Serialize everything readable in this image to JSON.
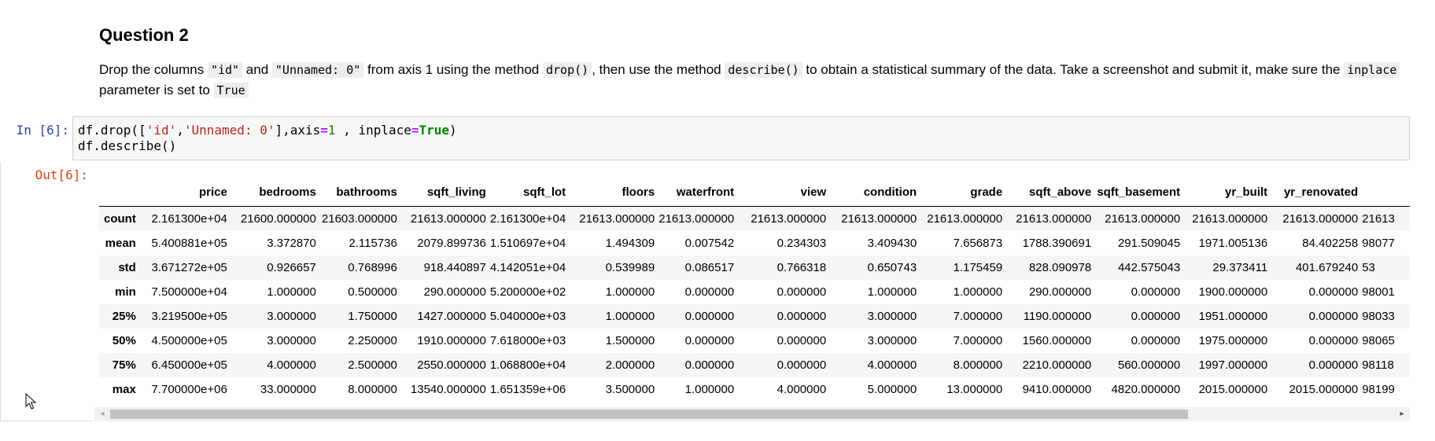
{
  "markdown": {
    "heading": "Question 2",
    "para": {
      "t1": "Drop the columns ",
      "c1": "\"id\"",
      "t2": " and ",
      "c2": "\"Unnamed: 0\"",
      "t3": " from axis 1 using the method ",
      "c3": "drop()",
      "t4": ", then use the method ",
      "c4": "describe()",
      "t5": " to obtain a statistical summary of the data. Take a screenshot and submit it, make sure the ",
      "c5": "inplace",
      "t6": " parameter is set to ",
      "c6": "True"
    }
  },
  "cell": {
    "in_prompt": "In [6]:",
    "out_prompt": "Out[6]:",
    "code": {
      "l1a": "df.drop([",
      "s1": "'id'",
      "l1b": ",",
      "s2": "'Unnamed: 0'",
      "l1c": "],axis",
      "op1": "=",
      "n1": "1",
      "l1d": " , inplace",
      "op2": "=",
      "kw1": "True",
      "l1e": ")",
      "l2": "df.describe()"
    }
  },
  "table": {
    "columns": [
      "price",
      "bedrooms",
      "bathrooms",
      "sqft_living",
      "sqft_lot",
      "floors",
      "waterfront",
      "view",
      "condition",
      "grade",
      "sqft_above",
      "sqft_basement",
      "yr_built",
      "yr_renovated",
      ""
    ],
    "rows": [
      {
        "label": "count",
        "cells": [
          "2.161300e+04",
          "21600.000000",
          "21603.000000",
          "21613.000000",
          "2.161300e+04",
          "21613.000000",
          "21613.000000",
          "21613.000000",
          "21613.000000",
          "21613.000000",
          "21613.000000",
          "21613.000000",
          "21613.000000",
          "21613.000000",
          "21613"
        ]
      },
      {
        "label": "mean",
        "cells": [
          "5.400881e+05",
          "3.372870",
          "2.115736",
          "2079.899736",
          "1.510697e+04",
          "1.494309",
          "0.007542",
          "0.234303",
          "3.409430",
          "7.656873",
          "1788.390691",
          "291.509045",
          "1971.005136",
          "84.402258",
          "98077"
        ]
      },
      {
        "label": "std",
        "cells": [
          "3.671272e+05",
          "0.926657",
          "0.768996",
          "918.440897",
          "4.142051e+04",
          "0.539989",
          "0.086517",
          "0.766318",
          "0.650743",
          "1.175459",
          "828.090978",
          "442.575043",
          "29.373411",
          "401.679240",
          "53"
        ]
      },
      {
        "label": "min",
        "cells": [
          "7.500000e+04",
          "1.000000",
          "0.500000",
          "290.000000",
          "5.200000e+02",
          "1.000000",
          "0.000000",
          "0.000000",
          "1.000000",
          "1.000000",
          "290.000000",
          "0.000000",
          "1900.000000",
          "0.000000",
          "98001"
        ]
      },
      {
        "label": "25%",
        "cells": [
          "3.219500e+05",
          "3.000000",
          "1.750000",
          "1427.000000",
          "5.040000e+03",
          "1.000000",
          "0.000000",
          "0.000000",
          "3.000000",
          "7.000000",
          "1190.000000",
          "0.000000",
          "1951.000000",
          "0.000000",
          "98033"
        ]
      },
      {
        "label": "50%",
        "cells": [
          "4.500000e+05",
          "3.000000",
          "2.250000",
          "1910.000000",
          "7.618000e+03",
          "1.500000",
          "0.000000",
          "0.000000",
          "3.000000",
          "7.000000",
          "1560.000000",
          "0.000000",
          "1975.000000",
          "0.000000",
          "98065"
        ]
      },
      {
        "label": "75%",
        "cells": [
          "6.450000e+05",
          "4.000000",
          "2.500000",
          "2550.000000",
          "1.068800e+04",
          "2.000000",
          "0.000000",
          "0.000000",
          "4.000000",
          "8.000000",
          "2210.000000",
          "560.000000",
          "1997.000000",
          "0.000000",
          "98118"
        ]
      },
      {
        "label": "max",
        "cells": [
          "7.700000e+06",
          "33.000000",
          "8.000000",
          "13540.000000",
          "1.651359e+06",
          "3.500000",
          "1.000000",
          "4.000000",
          "5.000000",
          "13.000000",
          "9410.000000",
          "4820.000000",
          "2015.000000",
          "2015.000000",
          "98199"
        ]
      }
    ]
  },
  "scrollbar": {
    "left_arrow": "◂",
    "right_arrow": "▸"
  }
}
